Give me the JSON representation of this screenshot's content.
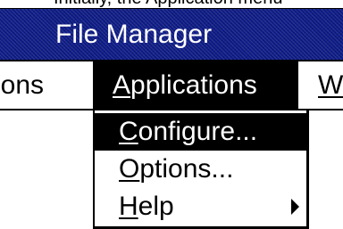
{
  "caption_fragment": "Initially, the Application menu",
  "window": {
    "title": "File Manager"
  },
  "menubar": {
    "items": [
      {
        "label_rest": "ions"
      },
      {
        "mnemonic": "A",
        "label_rest": "pplications"
      },
      {
        "mnemonic": "W",
        "label_rest": ""
      }
    ]
  },
  "dropdown": {
    "items": [
      {
        "mnemonic": "C",
        "label_rest": "onfigure..."
      },
      {
        "mnemonic": "O",
        "label_rest": "ptions..."
      },
      {
        "mnemonic": "H",
        "label_rest": "elp",
        "submenu_icon": "triangle-right-icon"
      }
    ]
  },
  "colors": {
    "titlebar": "#0f1d8a",
    "title_text": "#ffffff",
    "highlight": "#000000",
    "highlight_text": "#ffffff"
  }
}
